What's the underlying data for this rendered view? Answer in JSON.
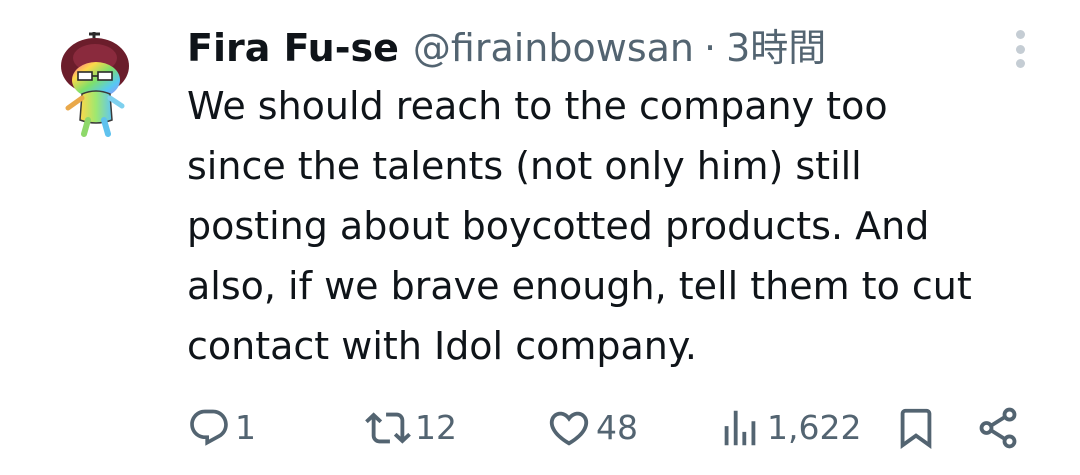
{
  "tweet": {
    "author_name": "Fira Fu-se",
    "handle": "@firainbowsan",
    "separator": "·",
    "time": "3時間",
    "text": "We should reach to the company too\nsince the talents (not only him) still\nposting about boycotted products. And\nalso, if we brave enough, tell them to cut\ncontact with Idol company."
  },
  "actions": {
    "replies": "1",
    "retweets": "12",
    "likes": "48",
    "views": "1,622"
  },
  "icons": {
    "more": "more-vertical-icon",
    "reply": "reply-icon",
    "retweet": "retweet-icon",
    "like": "heart-icon",
    "views": "views-icon",
    "bookmark": "bookmark-icon",
    "share": "share-icon"
  },
  "colors": {
    "text": "#0f1419",
    "secondary": "#536471",
    "more_dots": "#c5cdd4"
  }
}
